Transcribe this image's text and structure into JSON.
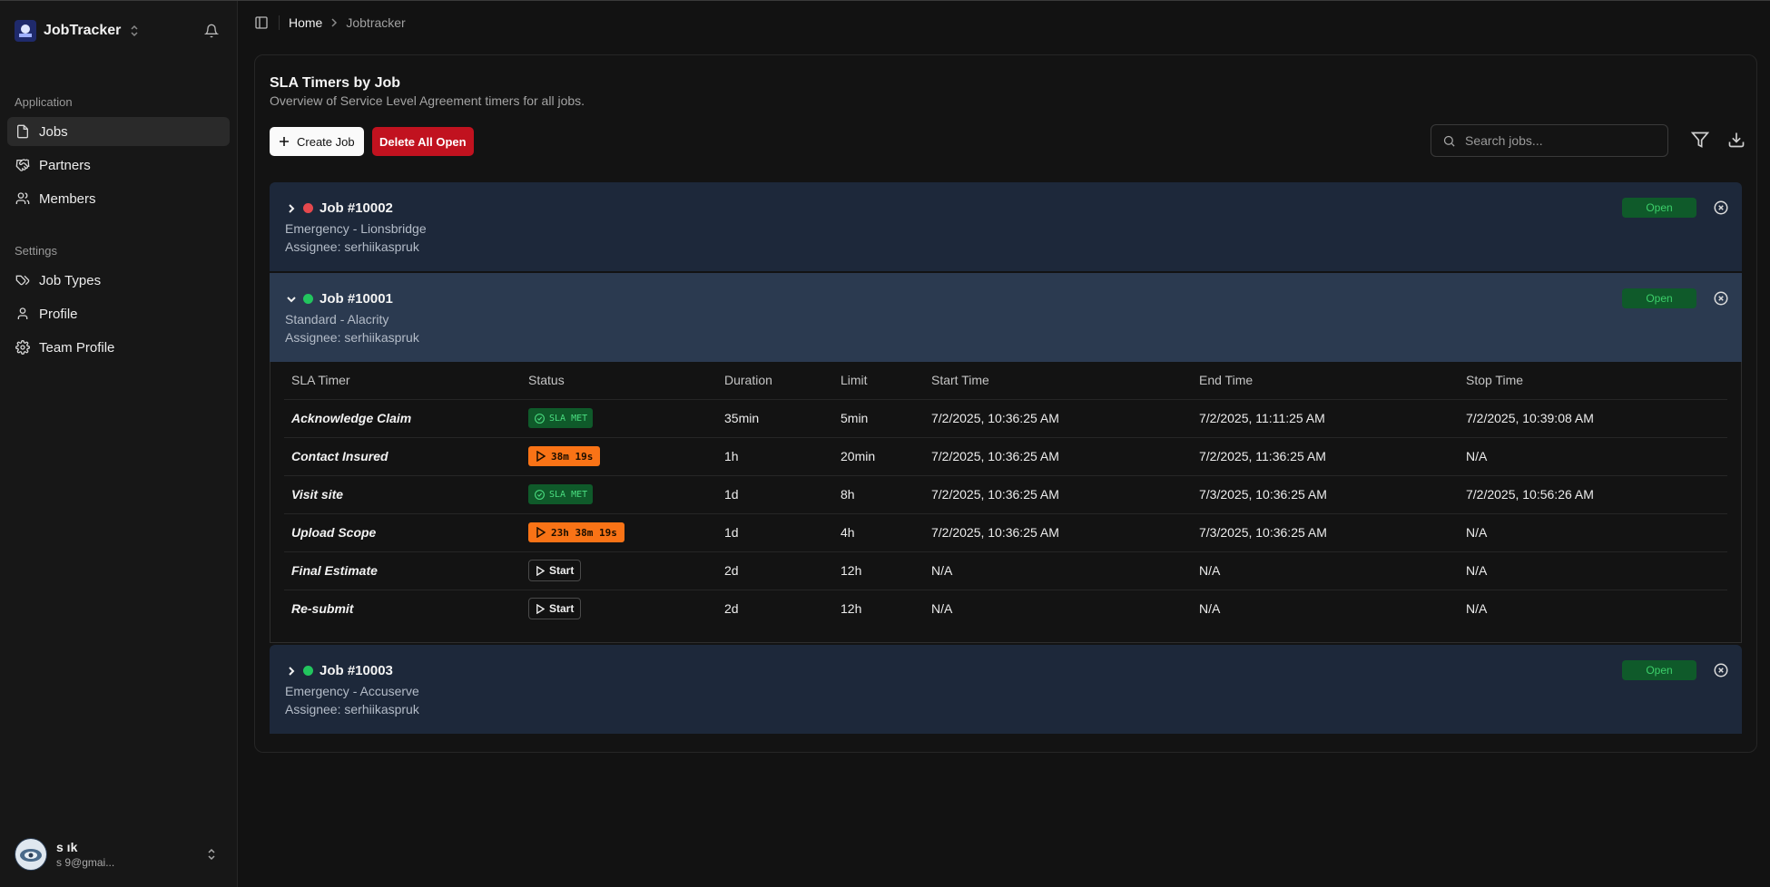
{
  "app": {
    "name": "JobTracker"
  },
  "nav": {
    "group_application": "Application",
    "group_settings": "Settings",
    "items": [
      {
        "label": "Jobs",
        "icon": "file-icon",
        "active": true
      },
      {
        "label": "Partners",
        "icon": "handshake-icon"
      },
      {
        "label": "Members",
        "icon": "users-icon"
      },
      {
        "label": "Job Types",
        "icon": "tags-icon"
      },
      {
        "label": "Profile",
        "icon": "user-icon"
      },
      {
        "label": "Team Profile",
        "icon": "gear-icon"
      }
    ]
  },
  "user": {
    "name": "s                    ık",
    "email": "s                    9@gmai..."
  },
  "breadcrumb": {
    "home": "Home",
    "current": "Jobtracker"
  },
  "page": {
    "title": "SLA Timers by Job",
    "subtitle": "Overview of Service Level Agreement timers for all jobs."
  },
  "toolbar": {
    "create_label": "Create Job",
    "delete_all_label": "Delete All Open",
    "search_placeholder": "Search jobs..."
  },
  "colors": {
    "red_dot": "#e5484d",
    "green_dot": "#22c55e",
    "open_badge": "#0f5a2a",
    "delete": "#c1121f",
    "timer": "#f97316"
  },
  "jobs": [
    {
      "title": "Job #10002",
      "type": "Emergency - Lionsbridge",
      "assignee": "Assignee: serhiikaspruk",
      "status": "Open",
      "dot": "red",
      "expanded": false
    },
    {
      "title": "Job #10001",
      "type": "Standard - Alacrity",
      "assignee": "Assignee: serhiikaspruk",
      "status": "Open",
      "dot": "green",
      "expanded": true
    },
    {
      "title": "Job #10003",
      "type": "Emergency - Accuserve",
      "assignee": "Assignee: serhiikaspruk",
      "status": "Open",
      "dot": "green",
      "expanded": false
    }
  ],
  "sla": {
    "columns": [
      "SLA Timer",
      "Status",
      "Duration",
      "Limit",
      "Start Time",
      "End Time",
      "Stop Time"
    ],
    "rows": [
      {
        "name": "Acknowledge Claim",
        "status": "SLA MET",
        "status_kind": "met",
        "duration": "35min",
        "limit": "5min",
        "start": "7/2/2025, 10:36:25 AM",
        "end": "7/2/2025, 11:11:25 AM",
        "stop": "7/2/2025, 10:39:08 AM"
      },
      {
        "name": "Contact Insured",
        "status": "38m 19s",
        "status_kind": "timer",
        "duration": "1h",
        "limit": "20min",
        "start": "7/2/2025, 10:36:25 AM",
        "end": "7/2/2025, 11:36:25 AM",
        "stop": "N/A"
      },
      {
        "name": "Visit site",
        "status": "SLA MET",
        "status_kind": "met",
        "duration": "1d",
        "limit": "8h",
        "start": "7/2/2025, 10:36:25 AM",
        "end": "7/3/2025, 10:36:25 AM",
        "stop": "7/2/2025, 10:56:26 AM"
      },
      {
        "name": "Upload Scope",
        "status": "23h 38m 19s",
        "status_kind": "timer",
        "duration": "1d",
        "limit": "4h",
        "start": "7/2/2025, 10:36:25 AM",
        "end": "7/3/2025, 10:36:25 AM",
        "stop": "N/A"
      },
      {
        "name": "Final Estimate",
        "status": "Start",
        "status_kind": "start",
        "duration": "2d",
        "limit": "12h",
        "start": "N/A",
        "end": "N/A",
        "stop": "N/A"
      },
      {
        "name": "Re-submit",
        "status": "Start",
        "status_kind": "start",
        "duration": "2d",
        "limit": "12h",
        "start": "N/A",
        "end": "N/A",
        "stop": "N/A"
      }
    ]
  }
}
